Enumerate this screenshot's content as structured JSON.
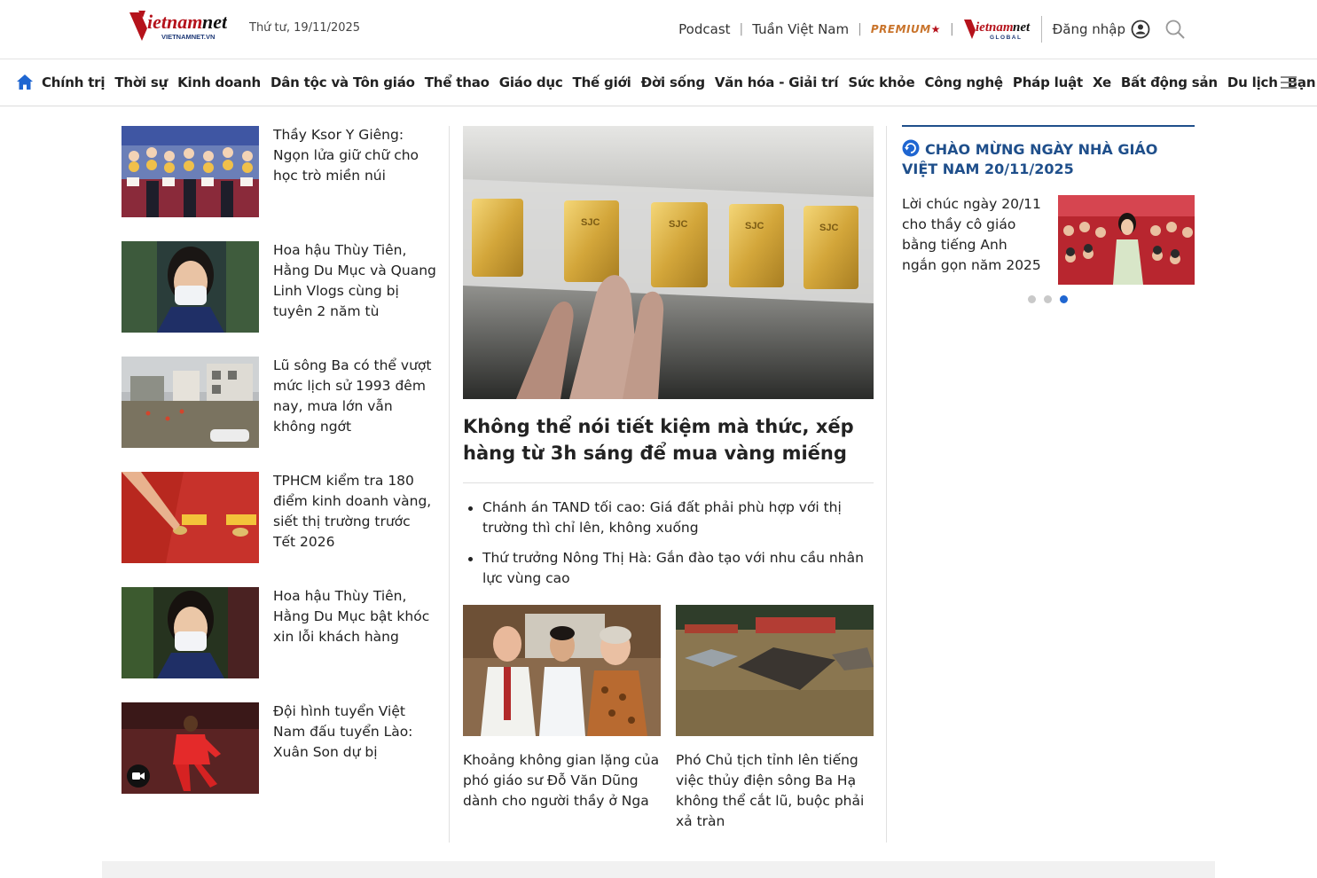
{
  "header": {
    "logo_text": "vietnamnet",
    "logo_sub": "VIETNAMNET.VN",
    "date": "Thứ tư, 19/11/2025",
    "links": [
      "Podcast",
      "Tuần Việt Nam"
    ],
    "premium_label": "PREMIUM",
    "global_logo_text": "vietnamnet",
    "global_logo_sub": "GLOBAL",
    "login_label": "Đăng nhập",
    "brand_color": "#b5121b"
  },
  "nav": {
    "items": [
      "Chính trị",
      "Thời sự",
      "Kinh doanh",
      "Dân tộc và Tôn giáo",
      "Thể thao",
      "Giáo dục",
      "Thế giới",
      "Đời sống",
      "Văn hóa - Giải trí",
      "Sức khỏe",
      "Công nghệ",
      "Pháp luật",
      "Xe",
      "Bất động sản",
      "Du lịch",
      "Bạn đọc"
    ]
  },
  "left_list": [
    {
      "title": "Thầy Ksor Y Giêng: Ngọn lửa giữ chữ cho học trò miền núi",
      "image": "teachers-award-photo"
    },
    {
      "title": "Hoa hậu Thùy Tiên, Hằng Du Mục và Quang Linh Vlogs cùng bị tuyên 2 năm tù",
      "image": "court-woman-mask-photo"
    },
    {
      "title": "Lũ sông Ba có thể vượt mức lịch sử 1993 đêm nay, mưa lớn vẫn không ngớt",
      "image": "flood-street-photo"
    },
    {
      "title": "TPHCM kiểm tra 180 điểm kinh doanh vàng, siết thị trường trước Tết 2026",
      "image": "gold-coin-red-photo"
    },
    {
      "title": "Hoa hậu Thùy Tiên, Hằng Du Mục bật khóc xin lỗi khách hàng",
      "image": "court-woman-mask-photo-2"
    },
    {
      "title": "Đội hình tuyển Việt Nam đấu tuyển Lào: Xuân Son dự bị",
      "image": "football-player-photo",
      "video": true
    }
  ],
  "main": {
    "hero_title": "Không thể nói tiết kiệm mà thức, xếp hàng từ 3h sáng để mua vàng miếng",
    "hero_bar_label": "SJC",
    "bullets": [
      "Chánh án TAND tối cao: Giá đất phải phù hợp với thị trường thì chỉ lên, không xuống",
      "Thứ trưởng Nông Thị Hà: Gắn đào tạo với nhu cầu nhân lực vùng cao"
    ],
    "sub_cards": [
      {
        "title": "Khoảng không gian lặng của phó giáo sư Đỗ Văn Dũng dành cho người thầy ở Nga",
        "image": "three-people-photo"
      },
      {
        "title": "Phó Chủ tịch tỉnh lên tiếng việc thủy điện sông Ba Hạ không thể cắt lũ, buộc phải xả tràn",
        "image": "flooded-roofs-photo"
      }
    ]
  },
  "right": {
    "heading": "CHÀO MỪNG NGÀY NHÀ GIÁO VIỆT NAM 20/11/2025",
    "card_title": "Lời chúc ngày 20/11 cho thầy cô giáo bằng tiếng Anh ngắn gọn năm 2025",
    "card_image": "students-celebration-photo",
    "slider_dots": 3,
    "slider_active": 3,
    "accent_color": "#1f4f8b"
  }
}
